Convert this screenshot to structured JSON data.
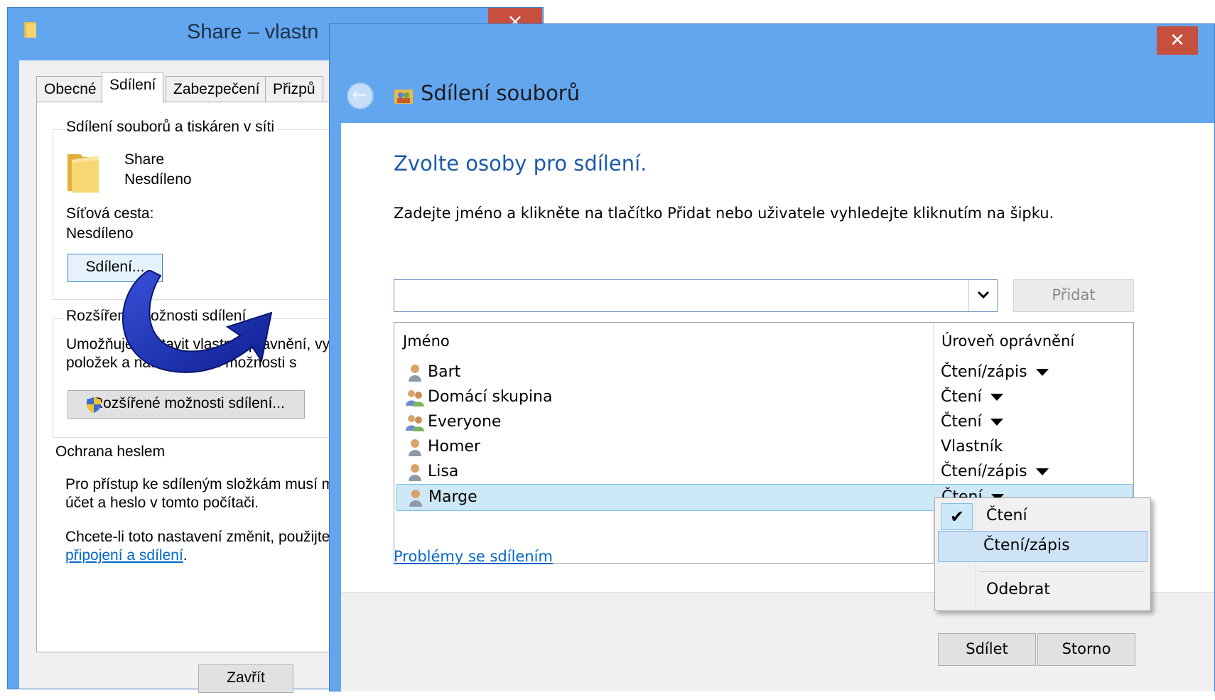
{
  "properties_window": {
    "title": "Share – vlastn",
    "close_glyph": "×",
    "tabs": [
      "Obecné",
      "Sdílení",
      "Zabezpečení",
      "Přizpů"
    ],
    "active_tab": "Sdílení",
    "group_share": {
      "title": "Sdílení souborů a tiskáren v síti",
      "folder_name": "Share",
      "folder_status": "Nesdíleno",
      "network_path_label": "Síťová cesta:",
      "network_path_value": "Nesdíleno",
      "share_button": "Sdílení..."
    },
    "group_advanced": {
      "title": "Rozšířené možnosti sdílení",
      "desc_line1": "Umožňuje nastavit vlastní oprávnění, vy",
      "desc_line2": "položek a nastavit další možnosti s",
      "button": "Rozšířené možnosti sdílení..."
    },
    "group_password": {
      "title": "Ochrana heslem",
      "line1": "Pro přístup ke sdíleným složkám musí m",
      "line2": "účet a heslo v tomto počítači.",
      "line3": "Chcete-li toto nastavení změnit, použijte",
      "link": "připojení a sdílení",
      "link_suffix": "."
    },
    "close_button": "Zavřít"
  },
  "share_dialog": {
    "close_glyph": "✕",
    "title": "Sdílení souborů",
    "heading": "Zvolte osoby pro sdílení.",
    "instruction": "Zadejte jméno a klikněte na tlačítko Přidat nebo uživatele vyhledejte kliknutím na šipku.",
    "name_input_value": "",
    "add_button": "Přidat",
    "columns": {
      "name": "Jméno",
      "permission": "Úroveň oprávnění"
    },
    "rows": [
      {
        "name": "Bart",
        "permission": "Čtení/zápis",
        "dropdown": true,
        "icon": "user-icon"
      },
      {
        "name": "Domácí skupina",
        "permission": "Čtení",
        "dropdown": true,
        "icon": "group-icon"
      },
      {
        "name": "Everyone",
        "permission": "Čtení",
        "dropdown": true,
        "icon": "group-icon"
      },
      {
        "name": "Homer",
        "permission": "Vlastník",
        "dropdown": false,
        "icon": "user-icon"
      },
      {
        "name": "Lisa",
        "permission": "Čtení/zápis",
        "dropdown": true,
        "icon": "user-icon"
      },
      {
        "name": "Marge",
        "permission": "Čtení",
        "dropdown": true,
        "icon": "user-icon",
        "selected": true
      }
    ],
    "trouble_link": "Problémy se sdílením",
    "permission_menu": {
      "items": [
        "Čtení",
        "Čtení/zápis",
        "Odebrat"
      ],
      "checked": "Čtení",
      "highlighted": "Čtení/zápis",
      "check_glyph": "✔"
    },
    "share_button": "Sdílet",
    "cancel_button": "Storno"
  },
  "colors": {
    "window_frame": "#63a6f0",
    "close_red": "#c74f3e",
    "heading_blue": "#1e5aa8",
    "selection": "#cde8f7",
    "arrow": "#1730a8"
  }
}
